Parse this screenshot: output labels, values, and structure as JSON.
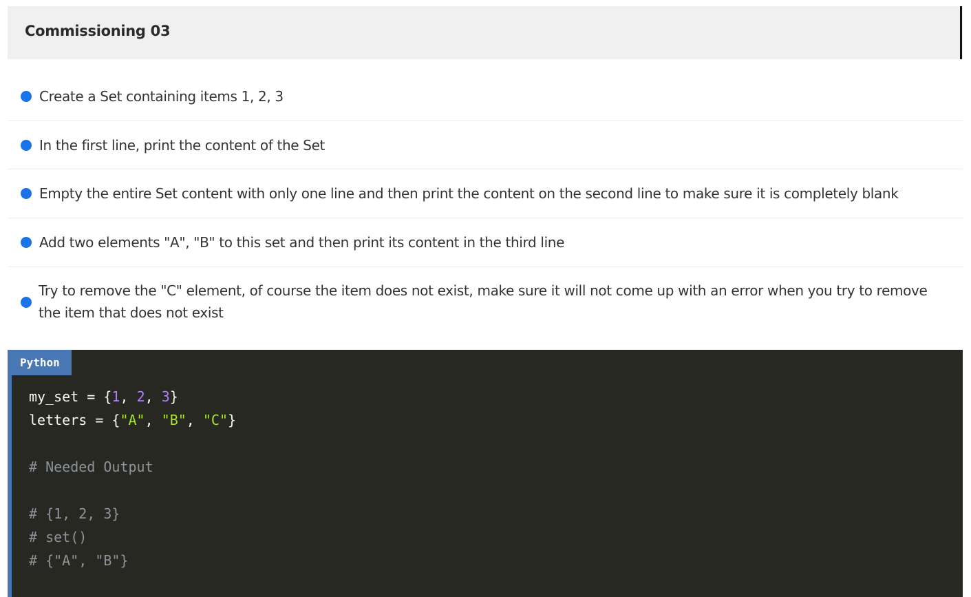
{
  "header": {
    "title": "Commissioning 03"
  },
  "tasks": [
    "Create a Set containing items 1, 2, 3",
    "In the first line, print the content of the Set",
    "Empty the entire Set content with only one line and then print the content on the second line to make sure it is completely blank",
    "Add two elements \"A\", \"B\" to this set and then print its content in the third line",
    "Try to remove the \"C\" element, of course the item does not exist, make sure it will not come up with an error when you try to remove the item that does not exist"
  ],
  "code": {
    "language": "Python",
    "lines": [
      [
        [
          "plain",
          "my_set = {"
        ],
        [
          "num",
          "1"
        ],
        [
          "plain",
          ", "
        ],
        [
          "num",
          "2"
        ],
        [
          "plain",
          ", "
        ],
        [
          "num",
          "3"
        ],
        [
          "plain",
          "}"
        ]
      ],
      [
        [
          "plain",
          "letters = {"
        ],
        [
          "str",
          "\"A\""
        ],
        [
          "plain",
          ", "
        ],
        [
          "str",
          "\"B\""
        ],
        [
          "plain",
          ", "
        ],
        [
          "str",
          "\"C\""
        ],
        [
          "plain",
          "}"
        ]
      ],
      [],
      [
        [
          "com",
          "# Needed Output"
        ]
      ],
      [],
      [
        [
          "com",
          "# {1, 2, 3}"
        ]
      ],
      [
        [
          "com",
          "# set()"
        ]
      ],
      [
        [
          "com",
          "# {\"A\", \"B\"}"
        ]
      ]
    ]
  },
  "colors": {
    "bullet": "#1a73e8",
    "code_bg": "#272822",
    "badge_bg": "#4a78b5",
    "number": "#ae81ff",
    "string": "#a6e22e",
    "comment": "#8f949c"
  },
  "icons": {
    "bullet": "bullet-dot-icon"
  }
}
